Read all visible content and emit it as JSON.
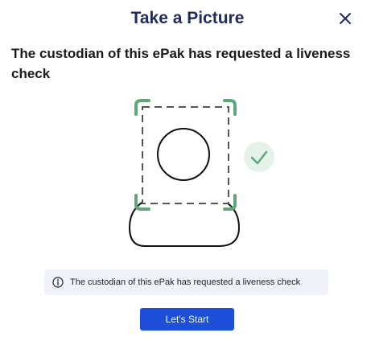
{
  "dialog": {
    "title": "Take a Picture",
    "close_icon": "close-icon",
    "heading": "The custodian of this ePak has requested a liveness check",
    "illustration": {
      "icon": "face-scan-illustration",
      "check_icon": "checkmark-icon",
      "accent_color": "#5fa77a",
      "check_bg_color": "#e4f2e9"
    },
    "info": {
      "icon": "info-icon",
      "text": "The custodian of this ePak has requested a liveness check"
    },
    "start_button": {
      "label": "Let's Start",
      "color": "#1d4fd8"
    }
  }
}
